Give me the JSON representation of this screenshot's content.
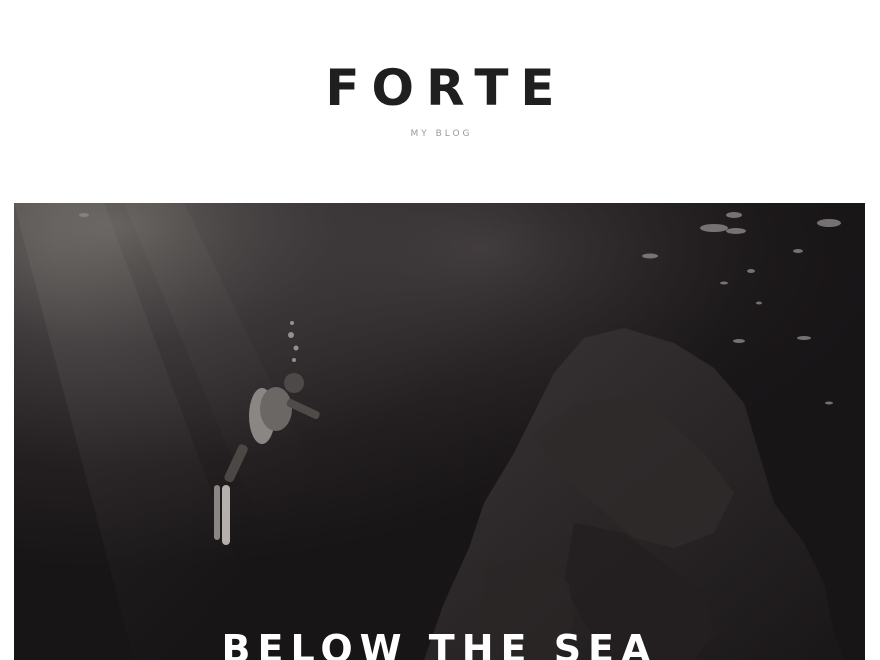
{
  "site": {
    "title": "FORTE",
    "tagline": "MY BLOG"
  },
  "featured_post": {
    "title": "BELOW THE SEA",
    "image_description_icon": "diver-underwater-photo"
  },
  "colors": {
    "background": "#ffffff",
    "title": "#1f1f1f",
    "tagline": "#9a9a9a",
    "hero_dark": "#1c191b",
    "hero_text": "#ffffff"
  }
}
